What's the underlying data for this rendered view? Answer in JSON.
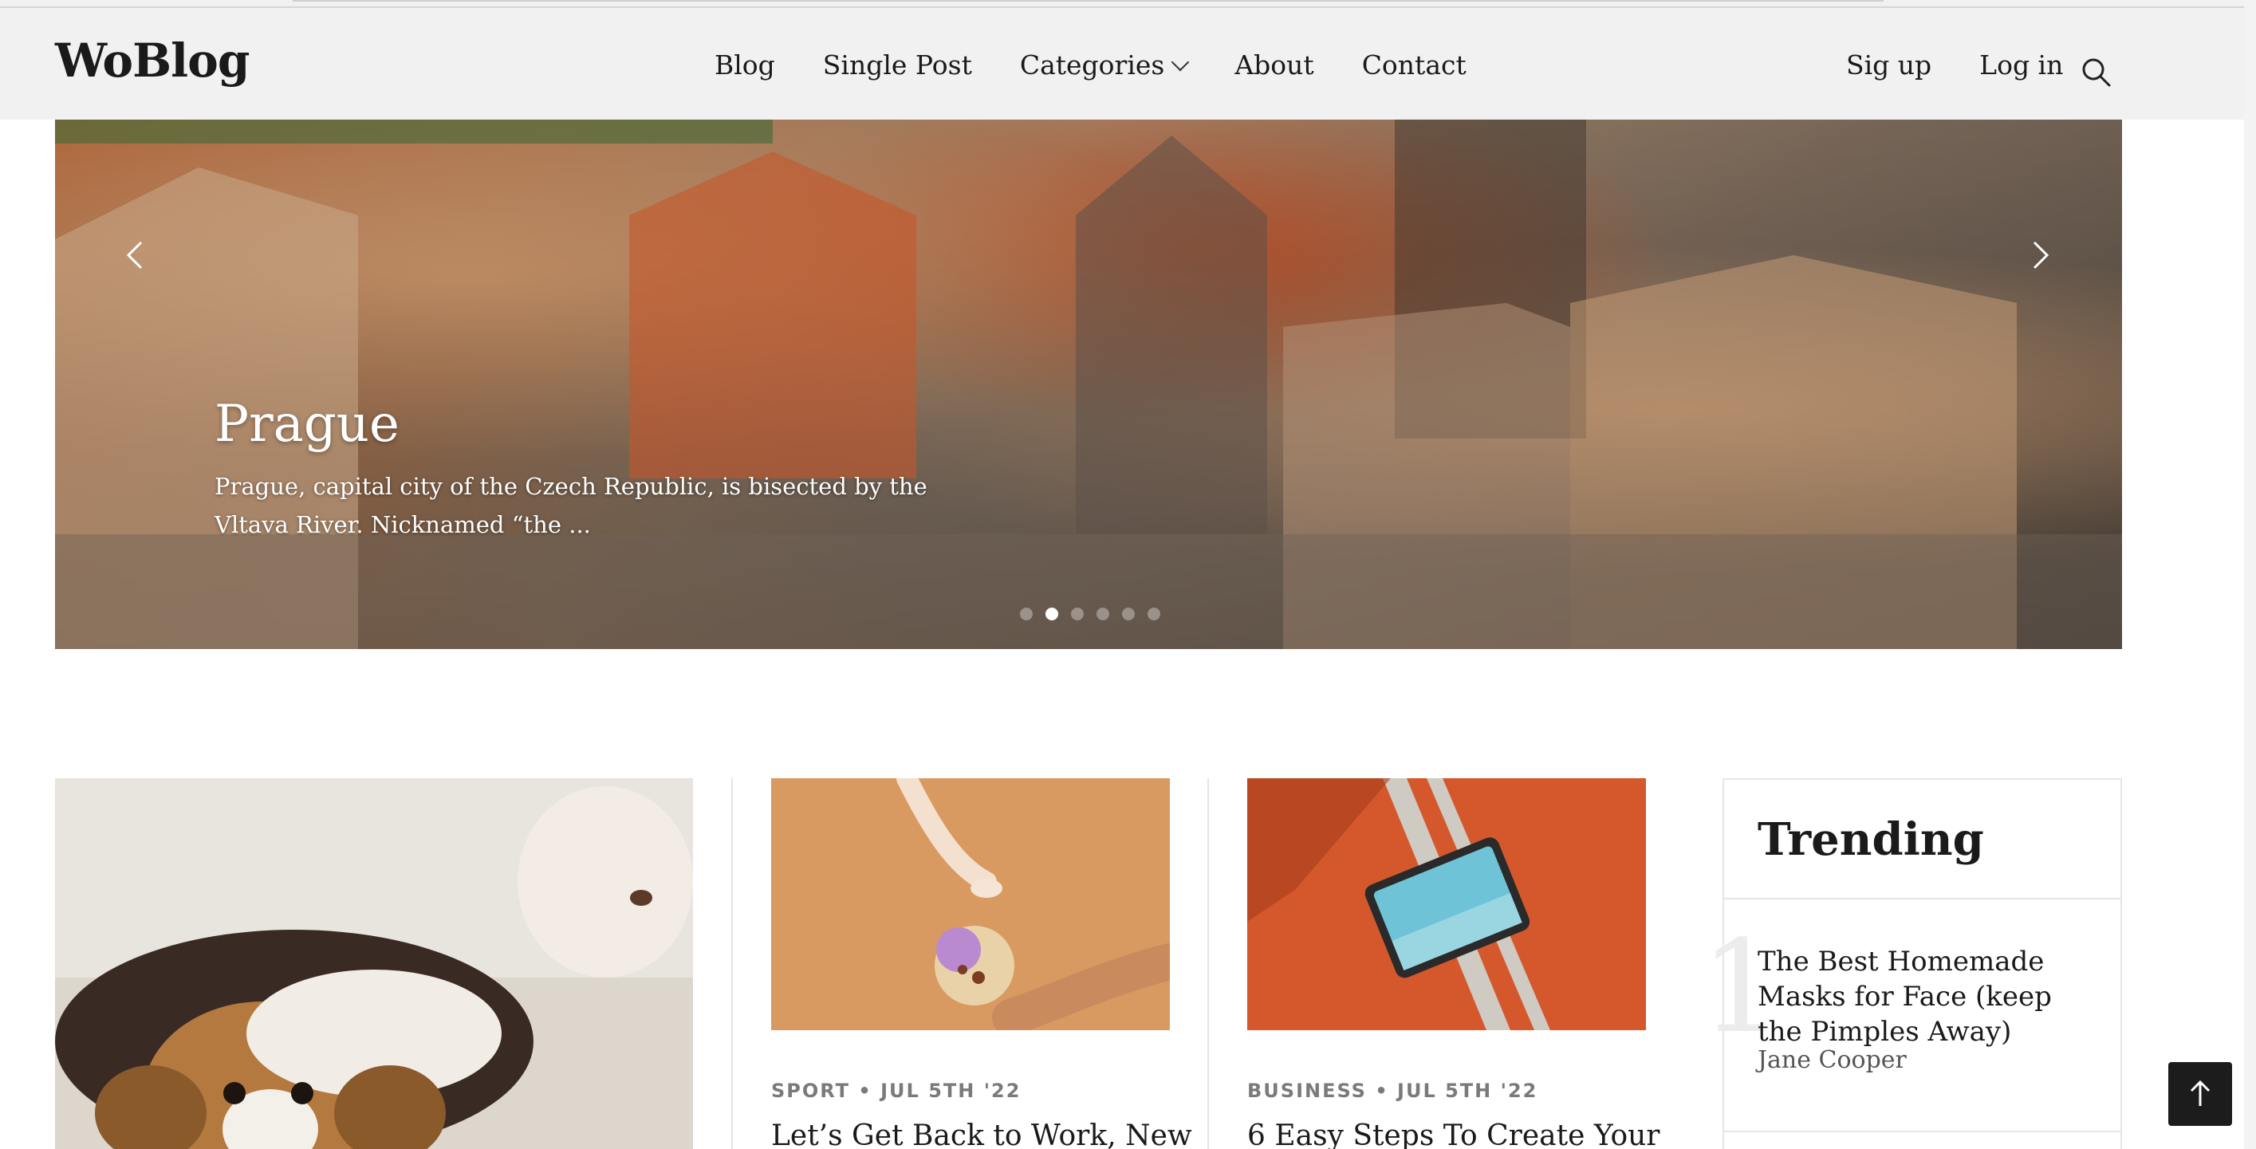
{
  "header": {
    "logo": "WoBlog",
    "nav": [
      "Blog",
      "Single Post",
      "Categories",
      "About",
      "Contact"
    ],
    "signup": "Sig up",
    "login": "Log in",
    "search_icon": "search-icon"
  },
  "hero": {
    "title": "Prague",
    "description": "Prague, capital city of the Czech Republic, is bisected by the Vltava River. Nicknamed “the ...",
    "dots": 6,
    "active_dot": 2
  },
  "cards": [
    {
      "category": "",
      "date": "",
      "title": ""
    },
    {
      "category": "SPORT",
      "date": "JUL 5TH '22",
      "title": "Let’s Get Back to Work, New"
    },
    {
      "category": "BUSINESS",
      "date": "JUL 5TH '22",
      "title": "6 Easy Steps To Create Your"
    }
  ],
  "trending": {
    "title": "Trending",
    "items": [
      {
        "number": "1",
        "title": "The Best Homemade Masks for Face (keep the Pimples Away)",
        "author": "Jane Cooper"
      }
    ]
  },
  "colors": {
    "header_bg": "#f1f1f1",
    "text": "#1a1a1a",
    "meta": "#7a7a7a",
    "back_to_top": "#1c1c1c"
  }
}
